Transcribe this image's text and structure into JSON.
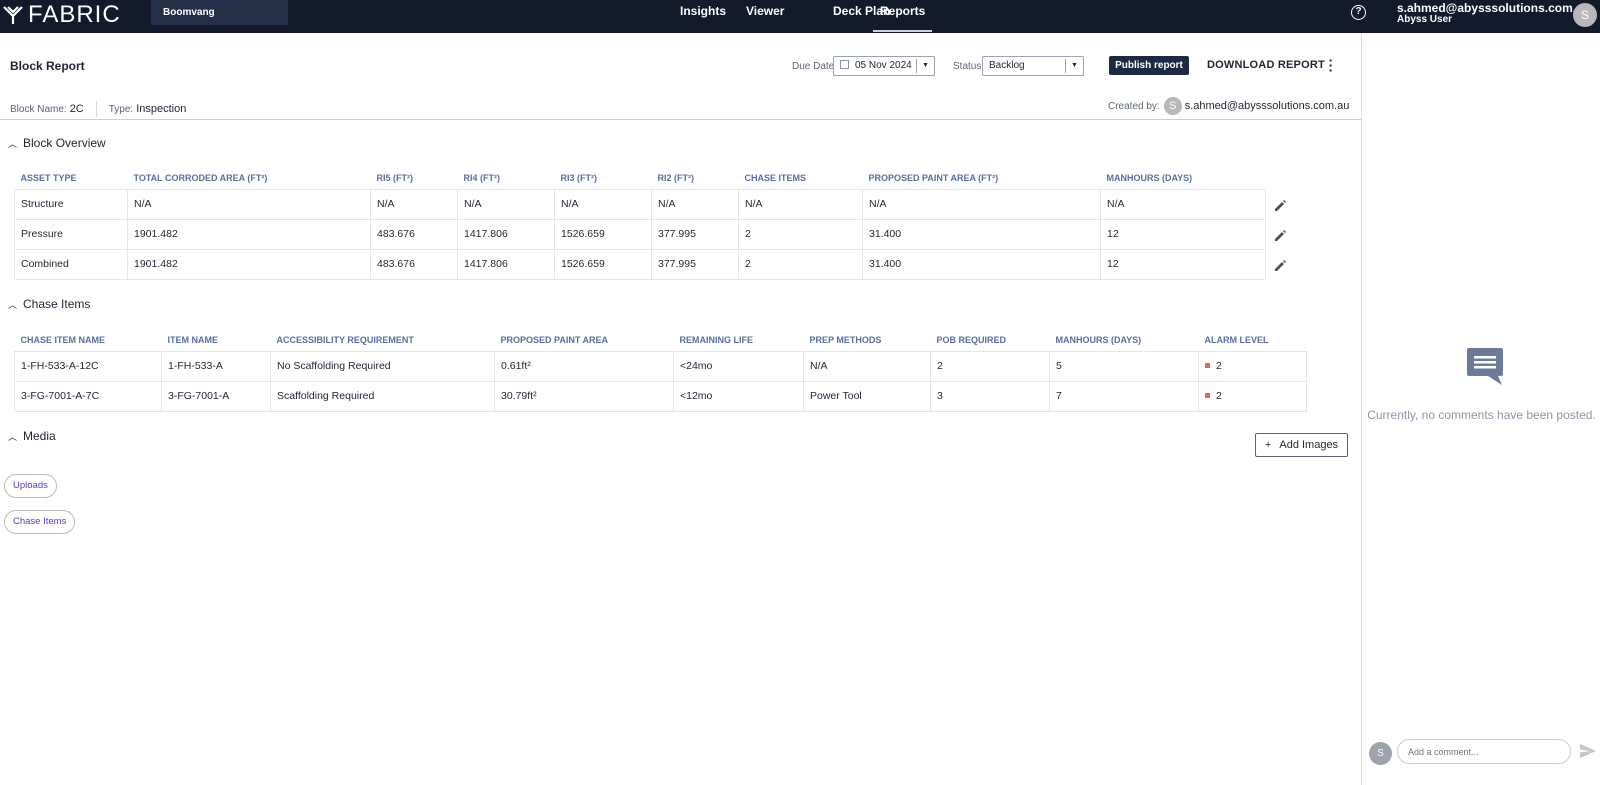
{
  "topbar": {
    "logo_text": "FABRIC",
    "site": "Boomvang",
    "nav": [
      "Insights",
      "Viewer",
      "Deck Plan",
      "Reports"
    ],
    "active_nav": "Reports",
    "user_email": "s.ahmed@abysssolutions.com.au",
    "user_role": "Abyss User",
    "avatar_initial": "S",
    "help_glyph": "?"
  },
  "header": {
    "title": "Block Report",
    "due_date_label": "Due Date",
    "due_date": "05 Nov 2024",
    "status_label": "Status",
    "status": "Backlog",
    "publish_label": "Publish report",
    "download_label": "DOWNLOAD REPORT",
    "block_name_label": "Block Name:",
    "block_name": "2C",
    "type_label": "Type:",
    "type": "Inspection",
    "created_by_label": "Created by:",
    "created_by_initial": "S",
    "created_by": "s.ahmed@abysssolutions.com.au"
  },
  "block_overview": {
    "title": "Block Overview",
    "columns": [
      "ASSET TYPE",
      "TOTAL CORRODED AREA (FT²)",
      "RI5 (FT²)",
      "RI4 (FT²)",
      "RI3 (FT²)",
      "RI2 (FT²)",
      "CHASE ITEMS",
      "PROPOSED PAINT AREA (FT²)",
      "MANHOURS (DAYS)"
    ],
    "rows": [
      [
        "Structure",
        "N/A",
        "N/A",
        "N/A",
        "N/A",
        "N/A",
        "N/A",
        "N/A",
        "N/A"
      ],
      [
        "Pressure",
        "1901.482",
        "483.676",
        "1417.806",
        "1526.659",
        "377.995",
        "2",
        "31.400",
        "12"
      ],
      [
        "Combined",
        "1901.482",
        "483.676",
        "1417.806",
        "1526.659",
        "377.995",
        "2",
        "31.400",
        "12"
      ]
    ]
  },
  "chase_items": {
    "title": "Chase Items",
    "columns": [
      "CHASE ITEM NAME",
      "ITEM NAME",
      "ACCESSIBILITY REQUIREMENT",
      "PROPOSED PAINT AREA",
      "REMAINING LIFE",
      "PREP METHODS",
      "POB REQUIRED",
      "MANHOURS (DAYS)",
      "ALARM LEVEL"
    ],
    "rows": [
      [
        "1-FH-533-A-12C",
        "1-FH-533-A",
        "No Scaffolding Required",
        "0.61ft²",
        "<24mo",
        "N/A",
        "2",
        "5",
        "2"
      ],
      [
        "3-FG-7001-A-7C",
        "3-FG-7001-A",
        "Scaffolding Required",
        "30.79ft²",
        "<12mo",
        "Power Tool",
        "3",
        "7",
        "2"
      ]
    ],
    "alarm_color": "#e06a6a"
  },
  "media": {
    "title": "Media",
    "add_images_label": "Add Images",
    "chips": [
      "Uploads",
      "Chase Items"
    ]
  },
  "comments": {
    "empty_text": "Currently, no comments have been posted.",
    "input_placeholder": "Add a comment...",
    "avatar_initial": "S"
  },
  "colors": {
    "topbar": "#121a2b",
    "accent": "#1e2a44",
    "header_text": "#5b6ea0"
  }
}
